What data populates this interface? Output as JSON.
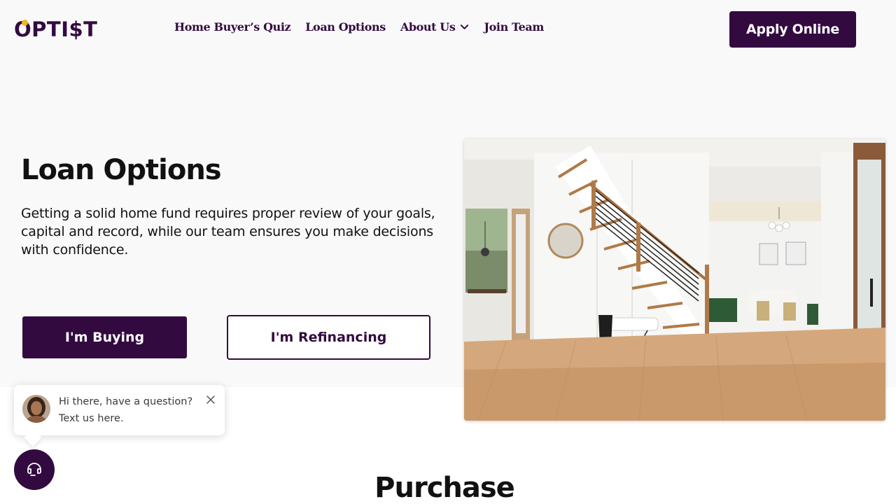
{
  "header": {
    "logo_text": "OPTI$T",
    "nav": [
      {
        "label": "Home Buyer’s Quiz"
      },
      {
        "label": "Loan Options"
      },
      {
        "label": "About Us",
        "has_dropdown": true
      },
      {
        "label": "Join Team"
      }
    ],
    "apply_label": "Apply Online"
  },
  "hero": {
    "title": "Loan Options",
    "description": "Getting a solid home fund requires proper review of your goals, capital and record, while our team ensures you make decisions with confidence.",
    "buy_label": "I'm Buying",
    "refinance_label": "I'm Refinancing",
    "image_icon": "interior-staircase-photo"
  },
  "chat": {
    "line1": "Hi there, have a question?",
    "line2": "Text us here.",
    "close_icon": "close-icon",
    "fab_icon": "chat-bubble-icon"
  },
  "section": {
    "title": "Purchase"
  },
  "colors": {
    "brand": "#330a40",
    "accent": "#e8b923",
    "hero_bg": "#f9f9f9"
  }
}
